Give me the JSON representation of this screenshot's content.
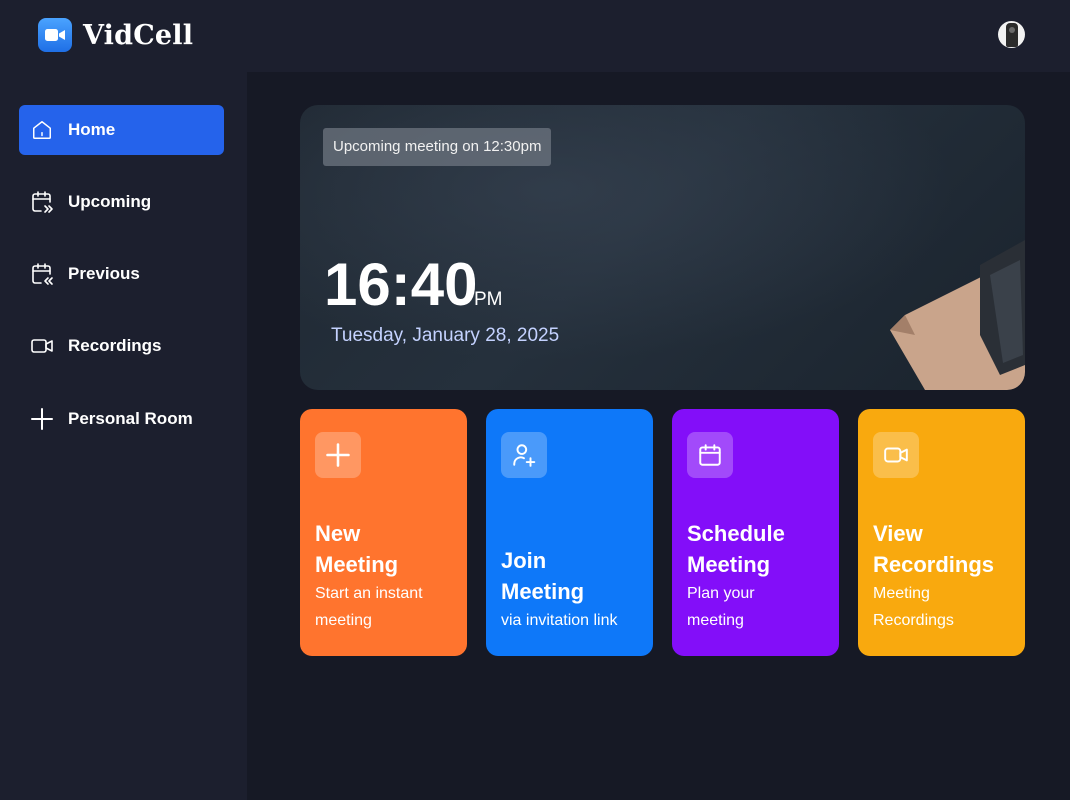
{
  "app": {
    "name": "VidCell",
    "logo_icon": "video-camera-icon",
    "avatar_icon": "user-avatar"
  },
  "sidebar": {
    "items": [
      {
        "label": "Home",
        "icon": "home-icon",
        "active": true
      },
      {
        "label": "Upcoming",
        "icon": "calendar-forward-icon",
        "active": false
      },
      {
        "label": "Previous",
        "icon": "calendar-back-icon",
        "active": false
      },
      {
        "label": "Recordings",
        "icon": "video-icon",
        "active": false
      },
      {
        "label": "Personal Room",
        "icon": "plus-icon",
        "active": false
      }
    ]
  },
  "hero": {
    "badge": "Upcoming meeting on 12:30pm",
    "time": "16:40",
    "ampm": "PM",
    "date": "Tuesday, January 28, 2025"
  },
  "cards": [
    {
      "title_line1": "New",
      "title_line2": "Meeting",
      "sub_line1": "Start an instant",
      "sub_line2": "meeting",
      "icon": "plus-icon",
      "color": "#ff742e"
    },
    {
      "title_line1": "Join",
      "title_line2": "Meeting",
      "sub_line1": "via invitation link",
      "sub_line2": "",
      "icon": "user-add-icon",
      "color": "#0e78f9"
    },
    {
      "title_line1": "Schedule",
      "title_line2": "Meeting",
      "sub_line1": "Plan your",
      "sub_line2": "meeting",
      "icon": "calendar-icon",
      "color": "#830ef9"
    },
    {
      "title_line1": "View",
      "title_line2": "Recordings",
      "sub_line1": "Meeting",
      "sub_line2": "Recordings",
      "icon": "video-icon",
      "color": "#f9a90e"
    }
  ],
  "colors": {
    "accent": "#2563eb",
    "sidebar_bg": "#1c1f2e",
    "main_bg": "#161925",
    "date_text": "#c4d2ff"
  }
}
